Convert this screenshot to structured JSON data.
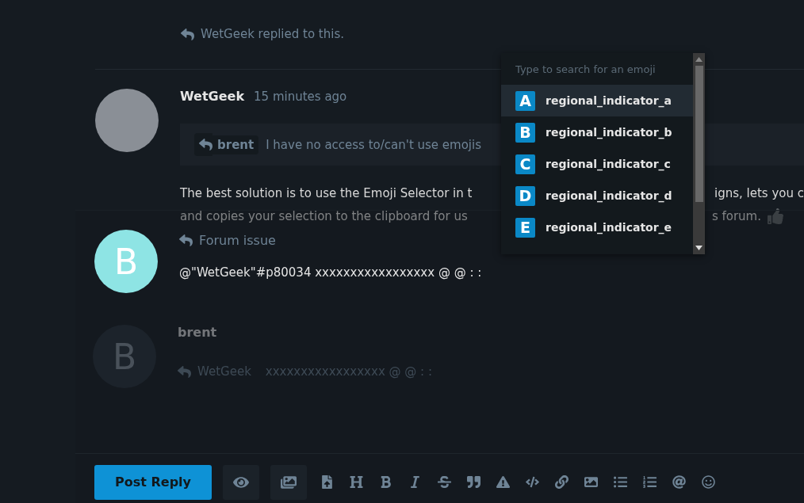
{
  "reply_notice": {
    "text": "WetGeek replied to this."
  },
  "post": {
    "author": "WetGeek",
    "time": "15 minutes ago",
    "quote": {
      "user": "brent",
      "text": "I have no access to/can't use emojis"
    },
    "body_lines": [
      {
        "left": "The best solution is to use the Emoji Selector in t",
        "right": "igns, lets you c"
      },
      {
        "left": "and copies your selection to the clipboard for us",
        "right": "s forum."
      }
    ]
  },
  "composer": {
    "avatar_letter": "B",
    "reply_to": "Forum issue",
    "text": "@\"WetGeek\"#p80034 xxxxxxxxxxxxxxxxx @ @ : :",
    "preview": {
      "avatar_letter": "B",
      "author": "brent",
      "reply_to": "WetGeek",
      "text": "xxxxxxxxxxxxxxxxx @ @ : :"
    },
    "submit": "Post Reply",
    "tools": [
      {
        "kind": "eye"
      },
      {
        "kind": "images"
      },
      {
        "kind": "upload"
      },
      {
        "kind": "heading"
      },
      {
        "kind": "bold"
      },
      {
        "kind": "italic"
      },
      {
        "kind": "strike"
      },
      {
        "kind": "quote"
      },
      {
        "kind": "warning"
      },
      {
        "kind": "code"
      },
      {
        "kind": "link"
      },
      {
        "kind": "image"
      },
      {
        "kind": "bullets"
      },
      {
        "kind": "numbers"
      },
      {
        "kind": "mention"
      },
      {
        "kind": "emoji"
      }
    ]
  },
  "emoji_popup": {
    "placeholder": "Type to search for an emoji",
    "items": [
      {
        "letter": "A",
        "name": "regional_indicator_a",
        "selected": true
      },
      {
        "letter": "B",
        "name": "regional_indicator_b",
        "selected": false
      },
      {
        "letter": "C",
        "name": "regional_indicator_c",
        "selected": false
      },
      {
        "letter": "D",
        "name": "regional_indicator_d",
        "selected": false
      },
      {
        "letter": "E",
        "name": "regional_indicator_e",
        "selected": false
      }
    ]
  }
}
